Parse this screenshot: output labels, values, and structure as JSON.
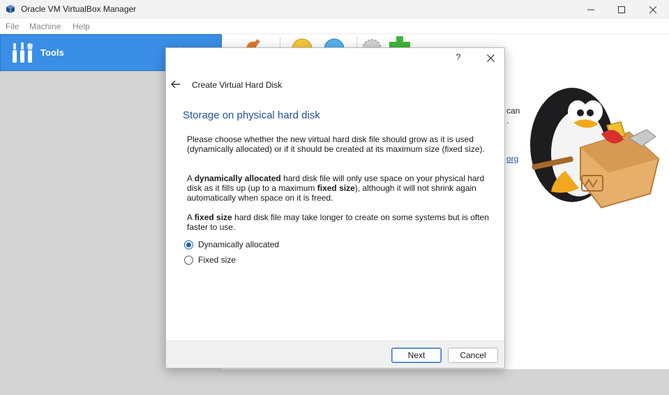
{
  "window": {
    "title": "Oracle VM VirtualBox Manager",
    "icons": [
      "virtualbox-cube-icon",
      "minimize-icon",
      "maximize-icon",
      "close-icon"
    ]
  },
  "menubar": {
    "items": [
      {
        "label": "File"
      },
      {
        "label": "Machine"
      },
      {
        "label": "Help"
      }
    ]
  },
  "left_panel": {
    "tools_label": "Tools",
    "selected_color": "#3a8ee6"
  },
  "welcome_fragments": {
    "line1_end": "can",
    "line2_end": ".",
    "link_end": "org"
  },
  "dialog": {
    "help_label": "?",
    "heading": "Create Virtual Hard Disk",
    "page_title": "Storage on physical hard disk",
    "paragraph1": "Please choose whether the new virtual hard disk file should grow as it is used (dynamically allocated) or if it should be created at its maximum size (fixed size).",
    "paragraph2": {
      "a": "A ",
      "b1": "dynamically allocated",
      "c": " hard disk file will only use space on your physical hard disk as it fills up (up to a maximum ",
      "b2": "fixed size",
      "d": "), although it will not shrink again automatically when space on it is freed."
    },
    "paragraph3": {
      "a": "A ",
      "b1": "fixed size",
      "c": " hard disk file may take longer to create on some systems but is often faster to use."
    },
    "options": [
      {
        "label": "Dynamically allocated",
        "checked": true
      },
      {
        "label": "Fixed size",
        "checked": false
      }
    ],
    "buttons": {
      "next": "Next",
      "cancel": "Cancel"
    },
    "accent_color": "#1b5fbf"
  }
}
